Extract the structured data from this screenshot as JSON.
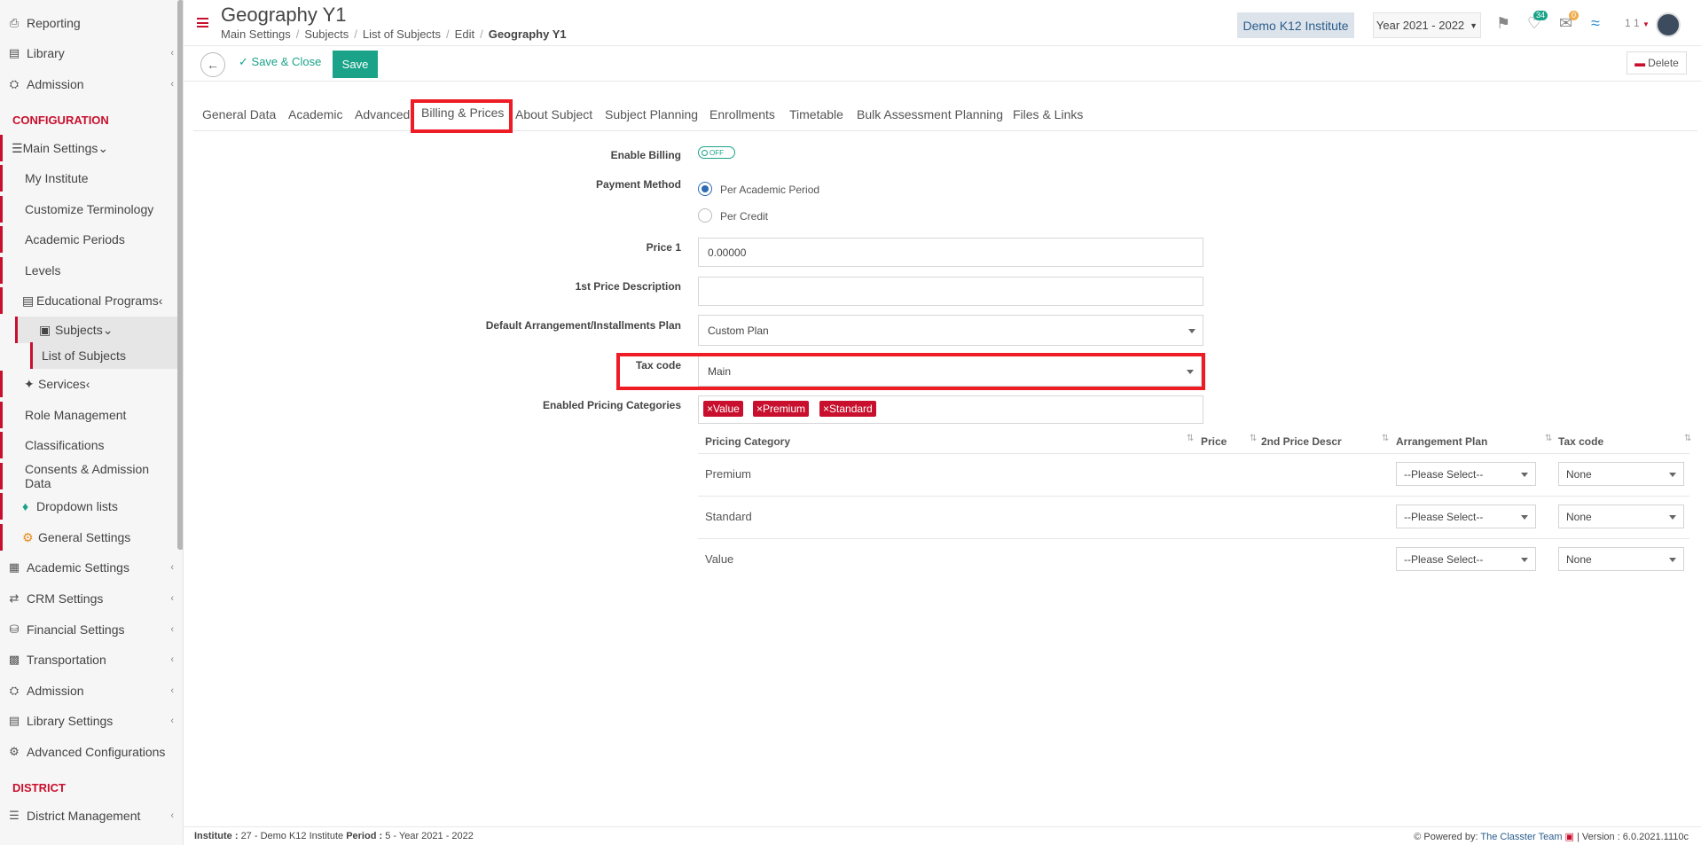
{
  "sidebar": {
    "top_items": [
      {
        "label": "Reporting",
        "icon": "print-icon"
      },
      {
        "label": "Library",
        "icon": "library-icon"
      },
      {
        "label": "Admission",
        "icon": "bank-icon"
      }
    ],
    "config_heading": "CONFIGURATION",
    "main_settings": "Main Settings",
    "main_items": [
      "My Institute",
      "Customize Terminology",
      "Academic Periods",
      "Levels",
      "Educational Programs",
      "Subjects",
      "List of Subjects",
      "Services",
      "Role Management",
      "Classifications",
      "Consents & Admission Data",
      "Dropdown lists",
      "General Settings"
    ],
    "bottom_items": [
      "Academic Settings",
      "CRM Settings",
      "Financial Settings",
      "Transportation",
      "Admission",
      "Library Settings",
      "Advanced Configurations"
    ],
    "district_heading": "DISTRICT",
    "district_item": "District Management"
  },
  "header": {
    "title": "Geography Y1",
    "breadcrumb": [
      "Main Settings",
      "Subjects",
      "List of Subjects",
      "Edit",
      "Geography Y1"
    ],
    "institute": "Demo K12 Institute",
    "year": "Year 2021 - 2022",
    "notif_count": "34",
    "mail_count": "0",
    "user": "1 1"
  },
  "toolbar": {
    "save_close": "Save & Close",
    "save": "Save",
    "delete": "Delete"
  },
  "tabs": [
    "General Data",
    "Academic",
    "Advanced",
    "Billing & Prices",
    "About Subject",
    "Subject Planning",
    "Enrollments",
    "Timetable",
    "Bulk Assessment Planning",
    "Files & Links"
  ],
  "active_tab": "Billing & Prices",
  "form": {
    "enable_billing_label": "Enable Billing",
    "enable_billing_value": "OFF",
    "payment_method_label": "Payment Method",
    "payment_options": [
      "Per Academic Period",
      "Per Credit"
    ],
    "payment_selected": "Per Academic Period",
    "price1_label": "Price 1",
    "price1_value": "0.00000",
    "price_desc_label": "1st Price Description",
    "price_desc_value": "",
    "plan_label": "Default Arrangement/Installments Plan",
    "plan_value": "Custom Plan",
    "tax_label": "Tax code",
    "tax_value": "Main",
    "pricing_label": "Enabled Pricing Categories",
    "pricing_tags": [
      "Value",
      "Premium",
      "Standard"
    ]
  },
  "table": {
    "headers": [
      "Pricing Category",
      "Price",
      "2nd Price Descr",
      "Arrangement Plan",
      "Tax code"
    ],
    "rows": [
      {
        "category": "Premium",
        "plan": "--Please Select--",
        "tax": "None"
      },
      {
        "category": "Standard",
        "plan": "--Please Select--",
        "tax": "None"
      },
      {
        "category": "Value",
        "plan": "--Please Select--",
        "tax": "None"
      }
    ]
  },
  "footer": {
    "institute_label": "Institute :",
    "institute_value": "27 - Demo K12 Institute",
    "period_label": "Period :",
    "period_value": "5 - Year 2021 - 2022",
    "powered": "Powered by:",
    "team": "The Classter Team",
    "version": "| Version : 6.0.2021.1110c"
  },
  "colors": {
    "accent": "#c8102e",
    "save_green": "#1aa389",
    "highlight": "#ee1c25",
    "link_blue": "#2a5d8c"
  }
}
